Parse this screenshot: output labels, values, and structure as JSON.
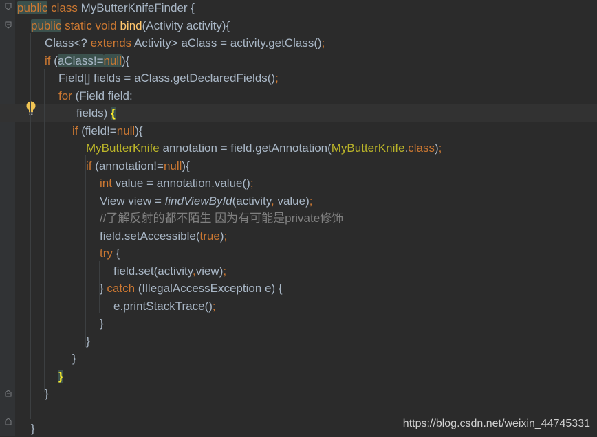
{
  "editor": {
    "lines": [
      {
        "indent": 0,
        "tokens": [
          {
            "t": "public",
            "c": "kw hl"
          },
          {
            "t": " class ",
            "c": "kw"
          },
          {
            "t": "MyButterKnifeFinder {",
            "c": ""
          }
        ]
      },
      {
        "indent": 1,
        "tokens": [
          {
            "t": "public",
            "c": "kw hl"
          },
          {
            "t": " static void ",
            "c": "kw"
          },
          {
            "t": "bind",
            "c": "fn"
          },
          {
            "t": "(Activity activity){",
            "c": ""
          }
        ]
      },
      {
        "indent": 2,
        "tokens": [
          {
            "t": "Class<? ",
            "c": ""
          },
          {
            "t": "extends",
            "c": "kw"
          },
          {
            "t": " Activity> aClass = activity.getClass()",
            "c": ""
          },
          {
            "t": ";",
            "c": "kw"
          }
        ]
      },
      {
        "indent": 2,
        "tokens": [
          {
            "t": "if",
            "c": "kw"
          },
          {
            "t": " (",
            "c": ""
          },
          {
            "t": "aClass!=",
            "c": "hl"
          },
          {
            "t": "null",
            "c": "kw hl"
          },
          {
            "t": "){",
            "c": ""
          }
        ]
      },
      {
        "indent": 3,
        "tokens": [
          {
            "t": "Field[] fields = aClass.getDeclaredFields()",
            "c": ""
          },
          {
            "t": ";",
            "c": "kw"
          }
        ]
      },
      {
        "indent": 3,
        "tokens": [
          {
            "t": "for",
            "c": "kw"
          },
          {
            "t": " (Field field:",
            "c": ""
          }
        ]
      },
      {
        "indent": 4,
        "extra": 6,
        "current": true,
        "tokens": [
          {
            "t": "fields) ",
            "c": ""
          },
          {
            "t": "{",
            "c": "brace-match"
          }
        ]
      },
      {
        "indent": 4,
        "tokens": [
          {
            "t": "if",
            "c": "kw"
          },
          {
            "t": " (field!=",
            "c": ""
          },
          {
            "t": "null",
            "c": "kw"
          },
          {
            "t": "){",
            "c": ""
          }
        ]
      },
      {
        "indent": 5,
        "tokens": [
          {
            "t": "MyButterKnife",
            "c": "ann"
          },
          {
            "t": " annotation = field.getAnnotation(",
            "c": ""
          },
          {
            "t": "MyButterKnife",
            "c": "ann"
          },
          {
            "t": ".",
            "c": ""
          },
          {
            "t": "class",
            "c": "kw"
          },
          {
            "t": ")",
            "c": ""
          },
          {
            "t": ";",
            "c": "kw"
          }
        ]
      },
      {
        "indent": 5,
        "tokens": [
          {
            "t": "if",
            "c": "kw"
          },
          {
            "t": " (annotation!=",
            "c": ""
          },
          {
            "t": "null",
            "c": "kw"
          },
          {
            "t": "){",
            "c": ""
          }
        ]
      },
      {
        "indent": 6,
        "tokens": [
          {
            "t": "int",
            "c": "kw"
          },
          {
            "t": " value = annotation.value()",
            "c": ""
          },
          {
            "t": ";",
            "c": "kw"
          }
        ]
      },
      {
        "indent": 6,
        "tokens": [
          {
            "t": "View view = ",
            "c": ""
          },
          {
            "t": "findViewById",
            "c": "ital"
          },
          {
            "t": "(activity",
            "c": ""
          },
          {
            "t": ",",
            "c": "kw"
          },
          {
            "t": " value)",
            "c": ""
          },
          {
            "t": ";",
            "c": "kw"
          }
        ]
      },
      {
        "indent": 6,
        "tokens": [
          {
            "t": "//了解反射的都不陌生 因为有可能是private修饰",
            "c": "cmt"
          }
        ]
      },
      {
        "indent": 6,
        "tokens": [
          {
            "t": "field.setAccessible(",
            "c": ""
          },
          {
            "t": "true",
            "c": "kw"
          },
          {
            "t": ")",
            "c": ""
          },
          {
            "t": ";",
            "c": "kw"
          }
        ]
      },
      {
        "indent": 6,
        "tokens": [
          {
            "t": "try",
            "c": "kw"
          },
          {
            "t": " {",
            "c": ""
          }
        ]
      },
      {
        "indent": 7,
        "tokens": [
          {
            "t": "field.set(activity",
            "c": ""
          },
          {
            "t": ",",
            "c": "kw"
          },
          {
            "t": "view)",
            "c": ""
          },
          {
            "t": ";",
            "c": "kw"
          }
        ]
      },
      {
        "indent": 6,
        "tokens": [
          {
            "t": "} ",
            "c": ""
          },
          {
            "t": "catch",
            "c": "kw"
          },
          {
            "t": " (IllegalAccessException e) {",
            "c": ""
          }
        ]
      },
      {
        "indent": 7,
        "tokens": [
          {
            "t": "e.printStackTrace()",
            "c": ""
          },
          {
            "t": ";",
            "c": "kw"
          }
        ]
      },
      {
        "indent": 6,
        "tokens": [
          {
            "t": "}",
            "c": ""
          }
        ]
      },
      {
        "indent": 5,
        "tokens": [
          {
            "t": "}",
            "c": ""
          }
        ]
      },
      {
        "indent": 4,
        "tokens": [
          {
            "t": "}",
            "c": ""
          }
        ]
      },
      {
        "indent": 3,
        "tokens": [
          {
            "t": "}",
            "c": "brace-match"
          }
        ]
      },
      {
        "indent": 2,
        "tokens": [
          {
            "t": "}",
            "c": ""
          }
        ]
      },
      {
        "indent": 1,
        "tokens": []
      },
      {
        "indent": 1,
        "tokens": [
          {
            "t": "}",
            "c": ""
          }
        ]
      }
    ]
  },
  "watermark": "https://blog.csdn.net/weixin_44745331",
  "icons": {
    "bulb": "lightbulb-icon",
    "fold": "fold-marker-icon"
  },
  "colors": {
    "background": "#2b2b2b",
    "keyword": "#cc7832",
    "method": "#ffc66d",
    "annotation": "#bbb529",
    "comment": "#808080",
    "text": "#a9b7c6"
  }
}
